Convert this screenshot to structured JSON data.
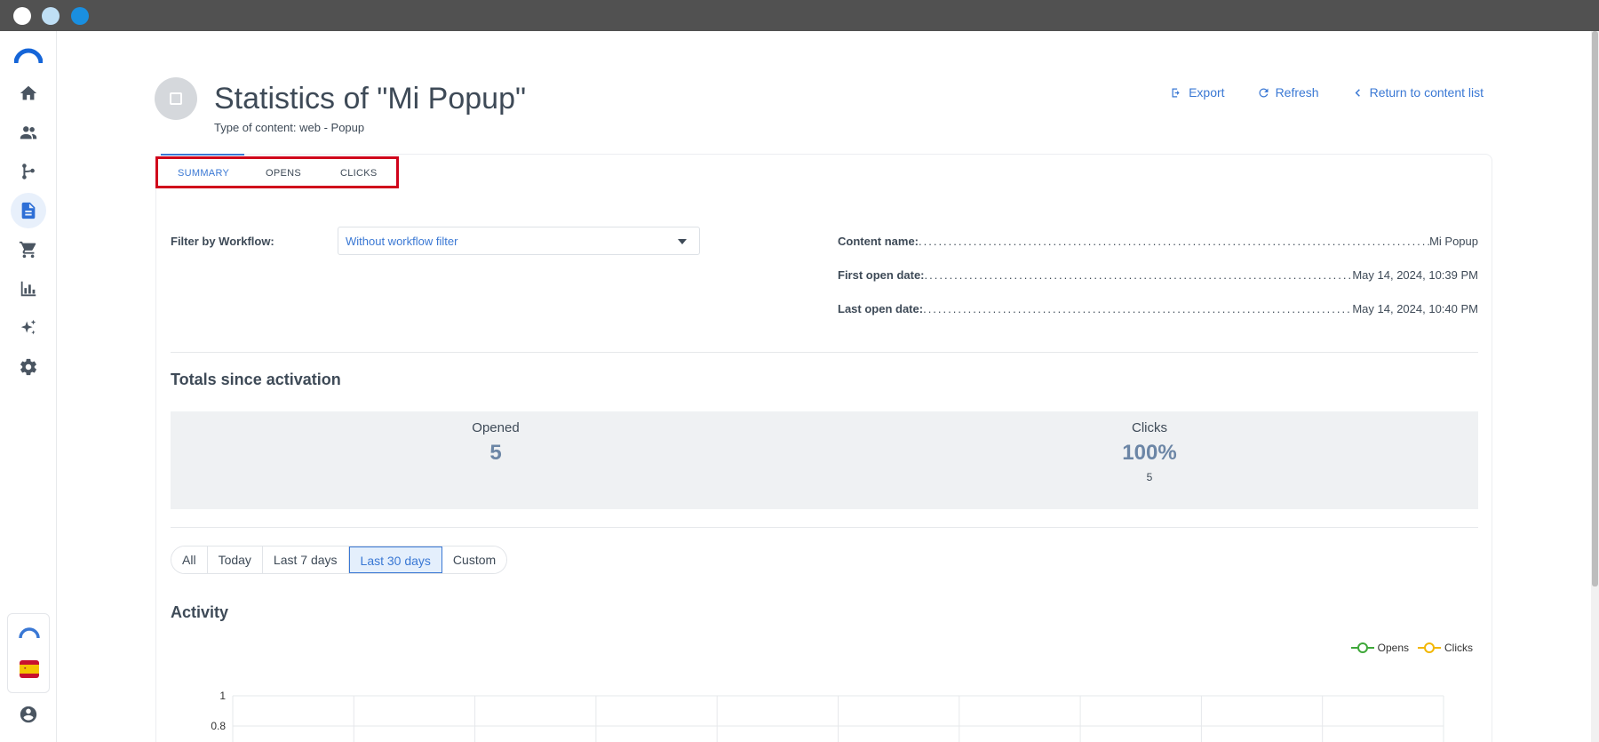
{
  "window": {
    "controls": [
      "close",
      "minimize",
      "maximize"
    ]
  },
  "sidebar": {
    "items": [
      {
        "icon": "home-icon"
      },
      {
        "icon": "people-icon"
      },
      {
        "icon": "workflow-icon"
      },
      {
        "icon": "document-icon",
        "active": true
      },
      {
        "icon": "cart-icon"
      },
      {
        "icon": "chart-icon"
      },
      {
        "icon": "sparkle-icon"
      },
      {
        "icon": "gear-icon"
      }
    ],
    "bottom": [
      "brand-logo-icon",
      "spain-flag-icon",
      "user-account-icon"
    ]
  },
  "header": {
    "title": "Statistics of \"Mi Popup\"",
    "subtitle": "Type of content: web - Popup",
    "actions": {
      "export": "Export",
      "refresh": "Refresh",
      "return": "Return to content list"
    }
  },
  "tabs": [
    {
      "label": "SUMMARY",
      "active": true
    },
    {
      "label": "OPENS"
    },
    {
      "label": "CLICKS"
    }
  ],
  "filter": {
    "label": "Filter by Workflow:",
    "value": "Without workflow filter"
  },
  "info": {
    "content_name": {
      "label": "Content name:",
      "value": "Mi Popup"
    },
    "first_open": {
      "label": "First open date:",
      "value": "May 14, 2024, 10:39 PM"
    },
    "last_open": {
      "label": "Last open date:",
      "value": "May 14, 2024, 10:40 PM"
    }
  },
  "totals": {
    "title": "Totals since activation",
    "opened": {
      "label": "Opened",
      "value": "5"
    },
    "clicks": {
      "label": "Clicks",
      "value": "100%",
      "sub": "5"
    }
  },
  "range": {
    "options": [
      "All",
      "Today",
      "Last 7 days",
      "Last 30 days",
      "Custom"
    ],
    "selected": "Last 30 days"
  },
  "activity": {
    "title": "Activity",
    "legend": [
      {
        "name": "Opens",
        "color": "#3fa83a"
      },
      {
        "name": "Clicks",
        "color": "#f2b705"
      }
    ]
  },
  "chart_data": {
    "type": "line",
    "y_ticks": [
      "1",
      "0.8"
    ],
    "ylim": [
      0,
      1
    ],
    "series": [
      {
        "name": "Opens",
        "color": "#3fa83a"
      },
      {
        "name": "Clicks",
        "color": "#f2b705"
      }
    ]
  },
  "colors": {
    "accent": "#3a78d4",
    "highlight_border": "#d0021b"
  }
}
